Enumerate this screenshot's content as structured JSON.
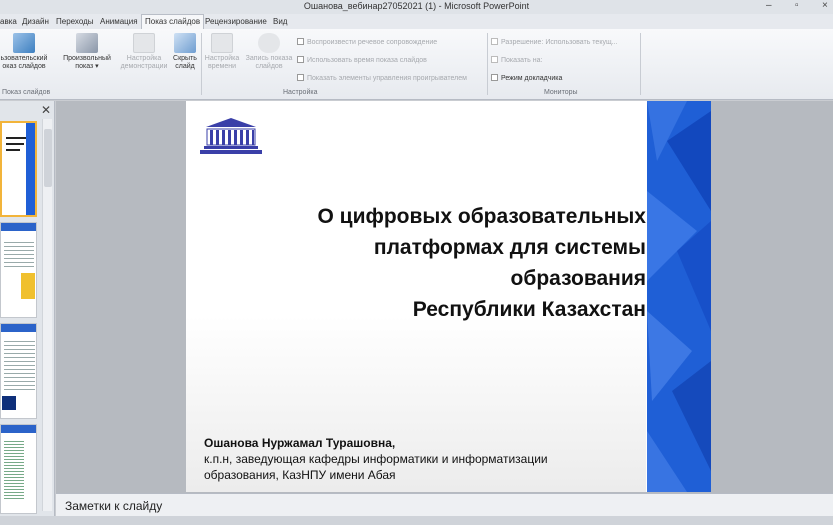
{
  "window": {
    "title": "Ошанова_вебинар27052021 (1) - Microsoft PowerPoint"
  },
  "tabs": [
    {
      "label": "авка"
    },
    {
      "label": "Дизайн"
    },
    {
      "label": "Переходы"
    },
    {
      "label": "Анимация"
    },
    {
      "label": "Показ слайдов"
    },
    {
      "label": "Рецензирование"
    },
    {
      "label": "Вид"
    }
  ],
  "ribbon": {
    "btn_presenter_l1": "ьзовательский",
    "btn_presenter_l2": "оказ слайдов",
    "btn_custom_l1": "Произвольный",
    "btn_custom_l2": "показ ▾",
    "btn_setup_l1": "Настройка",
    "btn_setup_l2": "демонстрации",
    "btn_hide_l1": "Скрыть",
    "btn_hide_l2": "слайд",
    "btn_timings_l1": "Настройка",
    "btn_timings_l2": "времени",
    "btn_record_l1": "Запись показа",
    "btn_record_l2": "слайдов",
    "check_narration": "Воспроизвести речевое сопровождение",
    "check_timings": "Использовать время показа слайдов",
    "check_controls": "Показать элементы управления проигрывателем",
    "resolution": "Разрешение: Использовать текущ...",
    "show_on": "Показать на:",
    "presenter_view": "Режим докладчика",
    "group_show": "Показ слайдов",
    "group_setup": "Настройка",
    "group_monitors": "Мониторы"
  },
  "slide": {
    "title_lines": [
      "О цифровых образовательных",
      "платформах для системы",
      "образования",
      "Республики Казахстан"
    ],
    "author_name": "Ошанова Нуржамал Турашовна,",
    "author_line2": "к.п.н, заведующая кафедры информатики и информатизации",
    "author_line3": "образования, КазНПУ имени Абая"
  },
  "notes": {
    "placeholder": "Заметки к слайду"
  },
  "colors": {
    "slide_band": "#1f5fd6",
    "selection": "#f2b43a",
    "logo": "#3a3fa8"
  },
  "icons": [
    "close-icon",
    "minimize-icon",
    "maximize-icon",
    "logo-icon"
  ]
}
